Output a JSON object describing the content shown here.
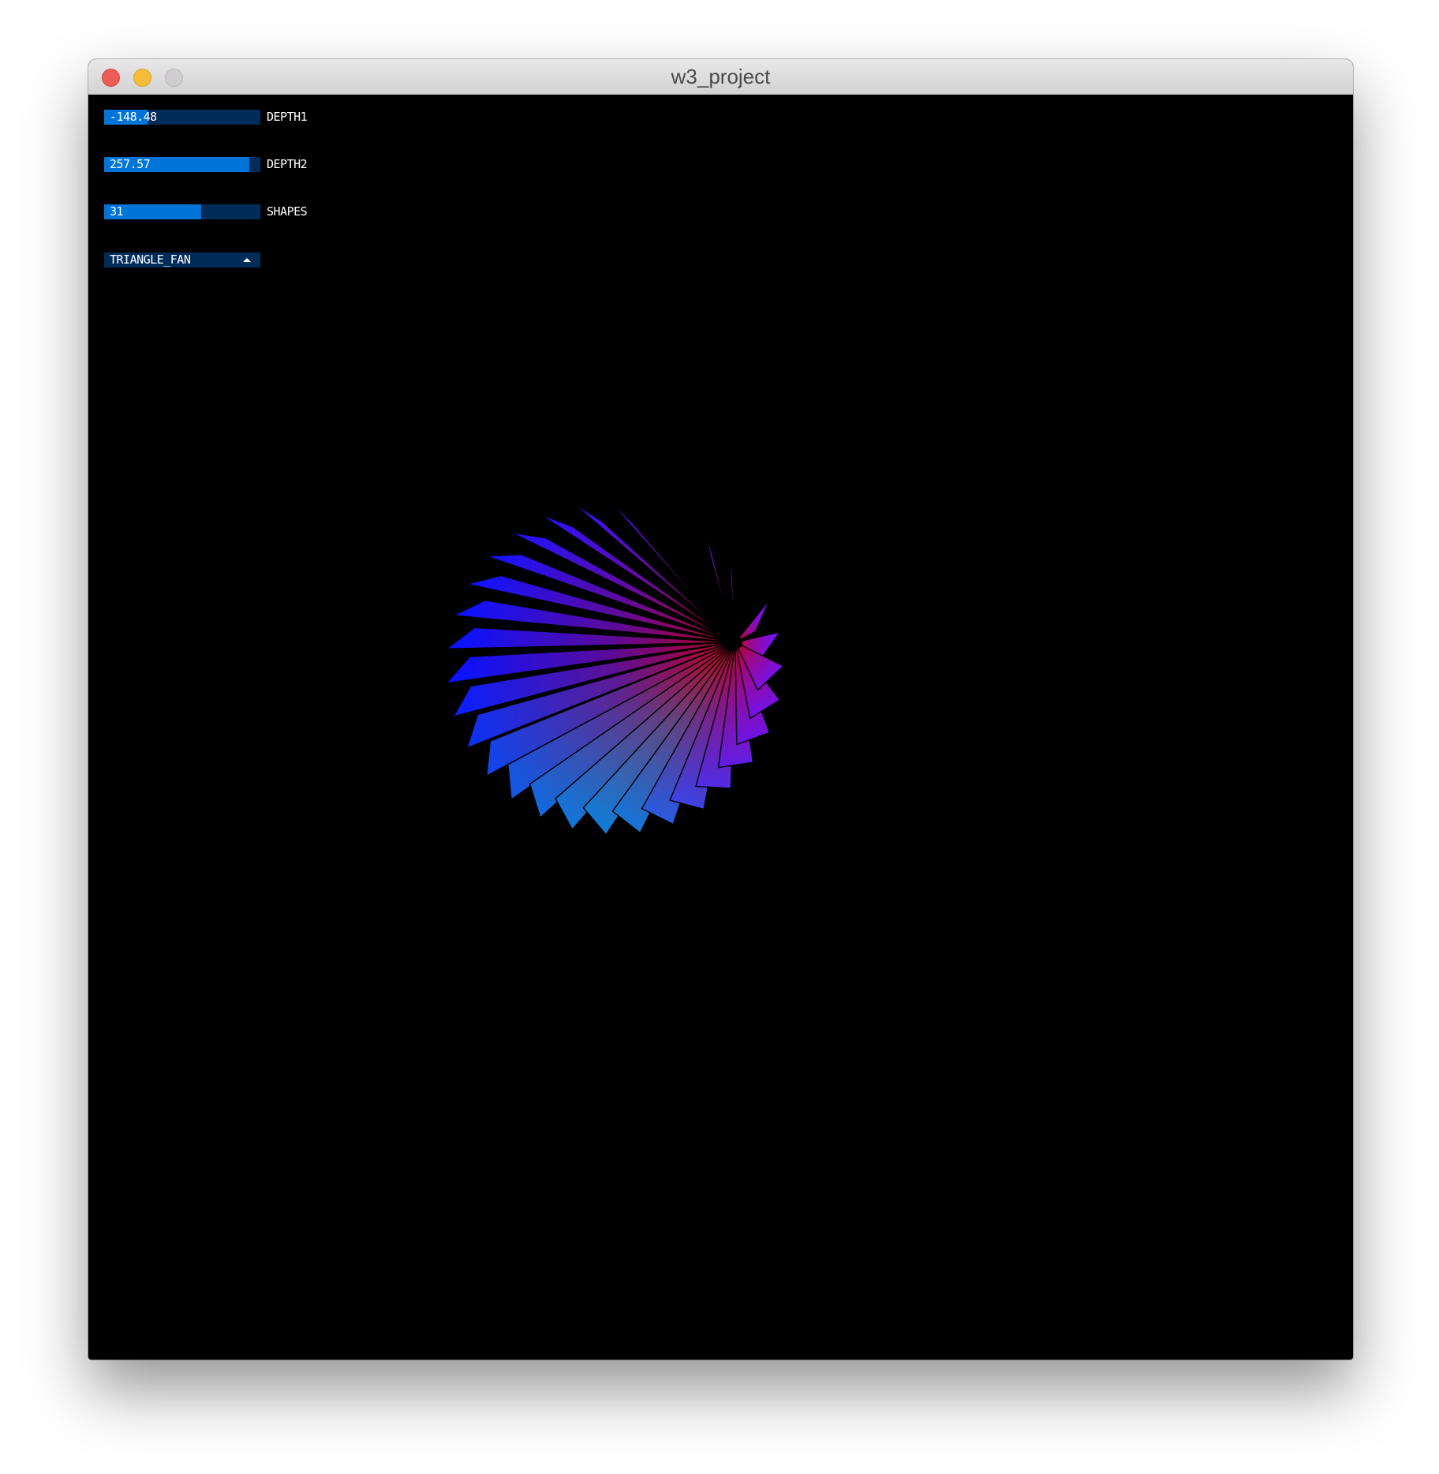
{
  "window": {
    "title": "w3_project"
  },
  "controls": {
    "sliders": [
      {
        "label": "DEPTH1",
        "value_text": "-148.48",
        "fill_fraction": 0.28
      },
      {
        "label": "DEPTH2",
        "value_text": "257.57",
        "fill_fraction": 0.93
      },
      {
        "label": "SHAPES",
        "value_text": "31",
        "fill_fraction": 0.62
      }
    ],
    "dropdown": {
      "selected": "TRIANGLE_FAN",
      "arrow_icon": "caret-up-icon"
    }
  },
  "colors": {
    "slider_track": "#002c5a",
    "slider_fill": "#0074d8",
    "canvas_background": "#000000",
    "fan_center": "#c0001c",
    "fan_rim_left": "#0a12ff",
    "fan_rim_right": "#7a10e6",
    "fan_rim_bottom": "#0b8fd0"
  },
  "scene": {
    "primitive": "TRIANGLE_FAN",
    "blade_count": 31
  }
}
